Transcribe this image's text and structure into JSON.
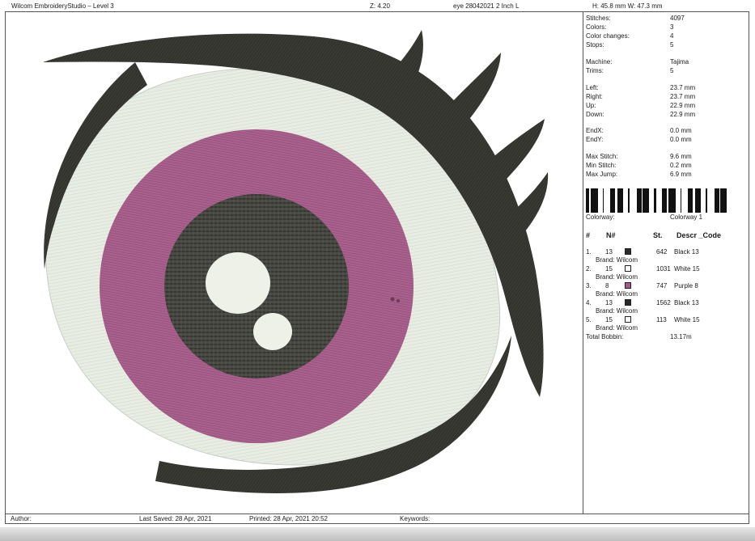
{
  "header": {
    "app_title": "Wilcom EmbroideryStudio – Level 3",
    "zoom": "Z: 4.20",
    "design_name": "eye 28042021 2 Inch L",
    "dimensions": "H: 45.8 mm   W: 47.3 mm"
  },
  "stats": [
    {
      "label": "Stitches:",
      "value": "4097"
    },
    {
      "label": "Colors:",
      "value": "3"
    },
    {
      "label": "Color changes:",
      "value": "4"
    },
    {
      "label": "Stops:",
      "value": "5"
    },
    {
      "label": "Machine:",
      "value": "Tajima"
    },
    {
      "label": "Trims:",
      "value": "5"
    },
    {
      "label": "Left:",
      "value": "23.7 mm"
    },
    {
      "label": "Right:",
      "value": "23.7 mm"
    },
    {
      "label": "Up:",
      "value": "22.9 mm"
    },
    {
      "label": "Down:",
      "value": "22.9 mm"
    },
    {
      "label": "EndX:",
      "value": "0.0 mm"
    },
    {
      "label": "EndY:",
      "value": "0.0 mm"
    },
    {
      "label": "Max Stitch:",
      "value": "9.6 mm"
    },
    {
      "label": "Min Stitch:",
      "value": "0.2 mm"
    },
    {
      "label": "Max Jump:",
      "value": "6.9 mm"
    }
  ],
  "colorway": {
    "label": "Colorway:",
    "value": "Colorway 1"
  },
  "table_headers": {
    "num": "#",
    "n": "N#",
    "st": "St.",
    "descr": "Descr _Code"
  },
  "colors": [
    {
      "index": "1.",
      "n": "13",
      "swatch": "#2a2a2a",
      "stitches": "642",
      "descr": "Black 13",
      "brand": "Brand: Wilcom"
    },
    {
      "index": "2.",
      "n": "15",
      "swatch": "#ffffff",
      "stitches": "1031",
      "descr": "White 15",
      "brand": "Brand: Wilcom"
    },
    {
      "index": "3.",
      "n": "8",
      "swatch": "#a85a86",
      "stitches": "747",
      "descr": "Purple 8",
      "brand": "Brand: Wilcom"
    },
    {
      "index": "4.",
      "n": "13",
      "swatch": "#2a2a2a",
      "stitches": "1562",
      "descr": "Black 13",
      "brand": "Brand: Wilcom"
    },
    {
      "index": "5.",
      "n": "15",
      "swatch": "#ffffff",
      "stitches": "113",
      "descr": "White 15",
      "brand": "Brand: Wilcom"
    }
  ],
  "total_bobbin": {
    "label": "Total Bobbin:",
    "value": "13.17m"
  },
  "footer": {
    "author": "Author:",
    "last_saved": "Last Saved: 28 Apr, 2021",
    "printed": "Printed: 28 Apr, 2021 20:52",
    "keywords": "Keywords:"
  },
  "thread_colors": {
    "black": "#3a3a35",
    "white": "#eaeee6",
    "purple": "#a8608c",
    "pupil": "#4a4a45"
  }
}
